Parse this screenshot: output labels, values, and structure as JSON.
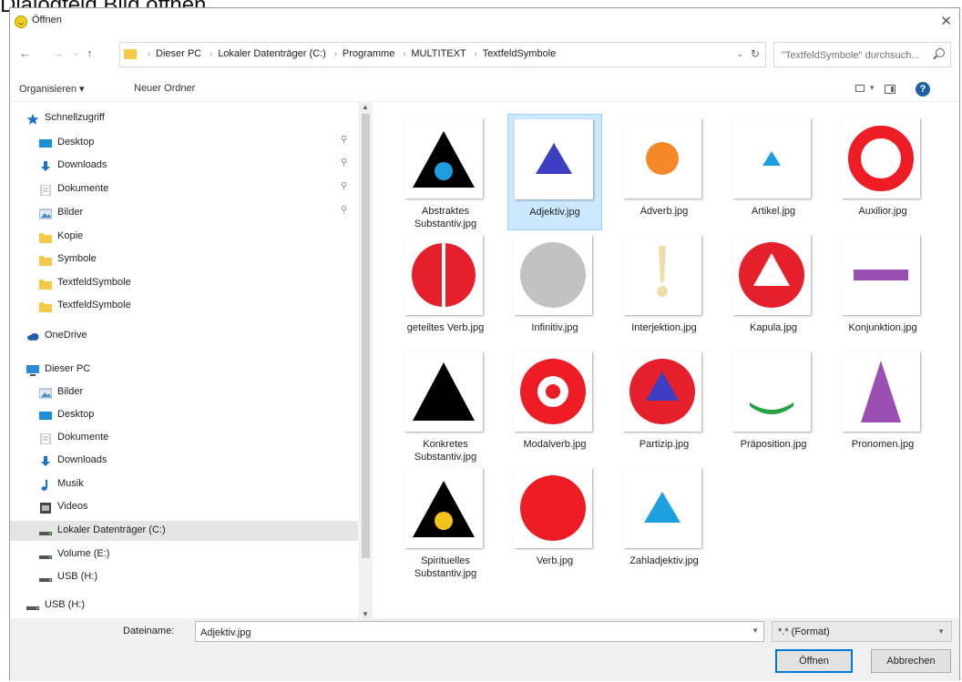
{
  "outer_caption": "Dialogfeld Bild öffnen",
  "window": {
    "title": "Öffnen",
    "close_glyph": "✕",
    "app_icon": "smiley-icon"
  },
  "nav": {
    "back": "←",
    "forward": "→",
    "recent": "⌄",
    "up": "↑"
  },
  "address": {
    "crumbs": [
      "Dieser PC",
      "Lokaler Datenträger (C:)",
      "Programme",
      "MULTITEXT",
      "TextfeldSymbole"
    ],
    "dropdown_glyph": "⌄",
    "refresh_glyph": "↻"
  },
  "search": {
    "placeholder": "\"TextfeldSymbole\" durchsuch..."
  },
  "toolbar": {
    "organize": "Organisieren ▾",
    "new_folder": "Neuer Ordner",
    "view_caret": "▾",
    "help": "?"
  },
  "sidebar": {
    "items": [
      {
        "label": "Schnellzugriff",
        "icon": "star-icon",
        "color": "#1a73c8",
        "pinned": false
      },
      {
        "label": "Desktop",
        "icon": "desktop-icon",
        "color": "#1a8fd8",
        "pinned": true
      },
      {
        "label": "Downloads",
        "icon": "download-icon",
        "color": "#1a73c8",
        "pinned": true
      },
      {
        "label": "Dokumente",
        "icon": "document-icon",
        "color": "#9aa6b2",
        "pinned": true
      },
      {
        "label": "Bilder",
        "icon": "pictures-icon",
        "color": "#4a8fc9",
        "pinned": true
      },
      {
        "label": "Kopie",
        "icon": "folder-icon",
        "color": "#f7c948",
        "pinned": false
      },
      {
        "label": "Symbole",
        "icon": "folder-icon",
        "color": "#f7c948",
        "pinned": false
      },
      {
        "label": "TextfeldSymbole",
        "icon": "folder-icon",
        "color": "#f7c948",
        "pinned": false
      },
      {
        "label": "TextfeldSymbole",
        "icon": "folder-icon",
        "color": "#f7c948",
        "pinned": false
      },
      {
        "label": "OneDrive",
        "icon": "cloud-icon",
        "color": "#1e5fa8",
        "pinned": false
      },
      {
        "label": "Dieser PC",
        "icon": "computer-icon",
        "color": "#2a8ad4",
        "pinned": false
      },
      {
        "label": "Bilder",
        "icon": "pictures-icon",
        "color": "#4a8fc9",
        "pinned": false
      },
      {
        "label": "Desktop",
        "icon": "desktop-icon",
        "color": "#1a8fd8",
        "pinned": false
      },
      {
        "label": "Dokumente",
        "icon": "document-icon",
        "color": "#9aa6b2",
        "pinned": false
      },
      {
        "label": "Downloads",
        "icon": "download-icon",
        "color": "#1a73c8",
        "pinned": false
      },
      {
        "label": "Musik",
        "icon": "music-icon",
        "color": "#1a73c8",
        "pinned": false
      },
      {
        "label": "Videos",
        "icon": "video-icon",
        "color": "#444444",
        "pinned": false
      },
      {
        "label": "Lokaler Datenträger (C:)",
        "icon": "drive-icon",
        "color": "#555555",
        "pinned": false,
        "selected": true
      },
      {
        "label": "Volume (E:)",
        "icon": "drive-icon",
        "color": "#555555",
        "pinned": false
      },
      {
        "label": "USB (H:)",
        "icon": "drive-icon",
        "color": "#555555",
        "pinned": false
      },
      {
        "label": "USB (H:)",
        "icon": "drive-icon",
        "color": "#555555",
        "pinned": false
      }
    ],
    "pin_glyph": "📌"
  },
  "files": [
    {
      "name": "Abstraktes Substantiv.jpg",
      "shape": "triangle-with-blue-dot"
    },
    {
      "name": "Adjektiv.jpg",
      "shape": "blue-triangle",
      "selected": true
    },
    {
      "name": "Adverb.jpg",
      "shape": "orange-circle"
    },
    {
      "name": "Artikel.jpg",
      "shape": "small-light-blue-triangle"
    },
    {
      "name": "Auxilior.jpg",
      "shape": "red-ring"
    },
    {
      "name": "geteiltes Verb.jpg",
      "shape": "split-red-circle"
    },
    {
      "name": "Infinitiv.jpg",
      "shape": "grey-circle"
    },
    {
      "name": "Interjektion.jpg",
      "shape": "exclamation-mark"
    },
    {
      "name": "Kapula.jpg",
      "shape": "red-circle-white-triangle"
    },
    {
      "name": "Konjunktion.jpg",
      "shape": "purple-bar"
    },
    {
      "name": "Konkretes Substantiv.jpg",
      "shape": "black-triangle"
    },
    {
      "name": "Modalverb.jpg",
      "shape": "red-target"
    },
    {
      "name": "Partizip.jpg",
      "shape": "red-circle-blue-triangle"
    },
    {
      "name": "Präposition.jpg",
      "shape": "green-arc"
    },
    {
      "name": "Pronomen.jpg",
      "shape": "purple-tall-triangle"
    },
    {
      "name": "Spirituelles Substantiv.jpg",
      "shape": "triangle-with-yellow-dot"
    },
    {
      "name": "Verb.jpg",
      "shape": "red-circle"
    },
    {
      "name": "Zahladjektiv.jpg",
      "shape": "light-blue-triangle"
    }
  ],
  "filename": {
    "label": "Dateiname:",
    "value": "Adjektiv.jpg"
  },
  "filetype": {
    "value": "*.* (Format)"
  },
  "buttons": {
    "open": "Öffnen",
    "cancel": "Abbrechen"
  },
  "colors": {
    "selection": "#cce8ff",
    "accent": "#0078d7"
  }
}
